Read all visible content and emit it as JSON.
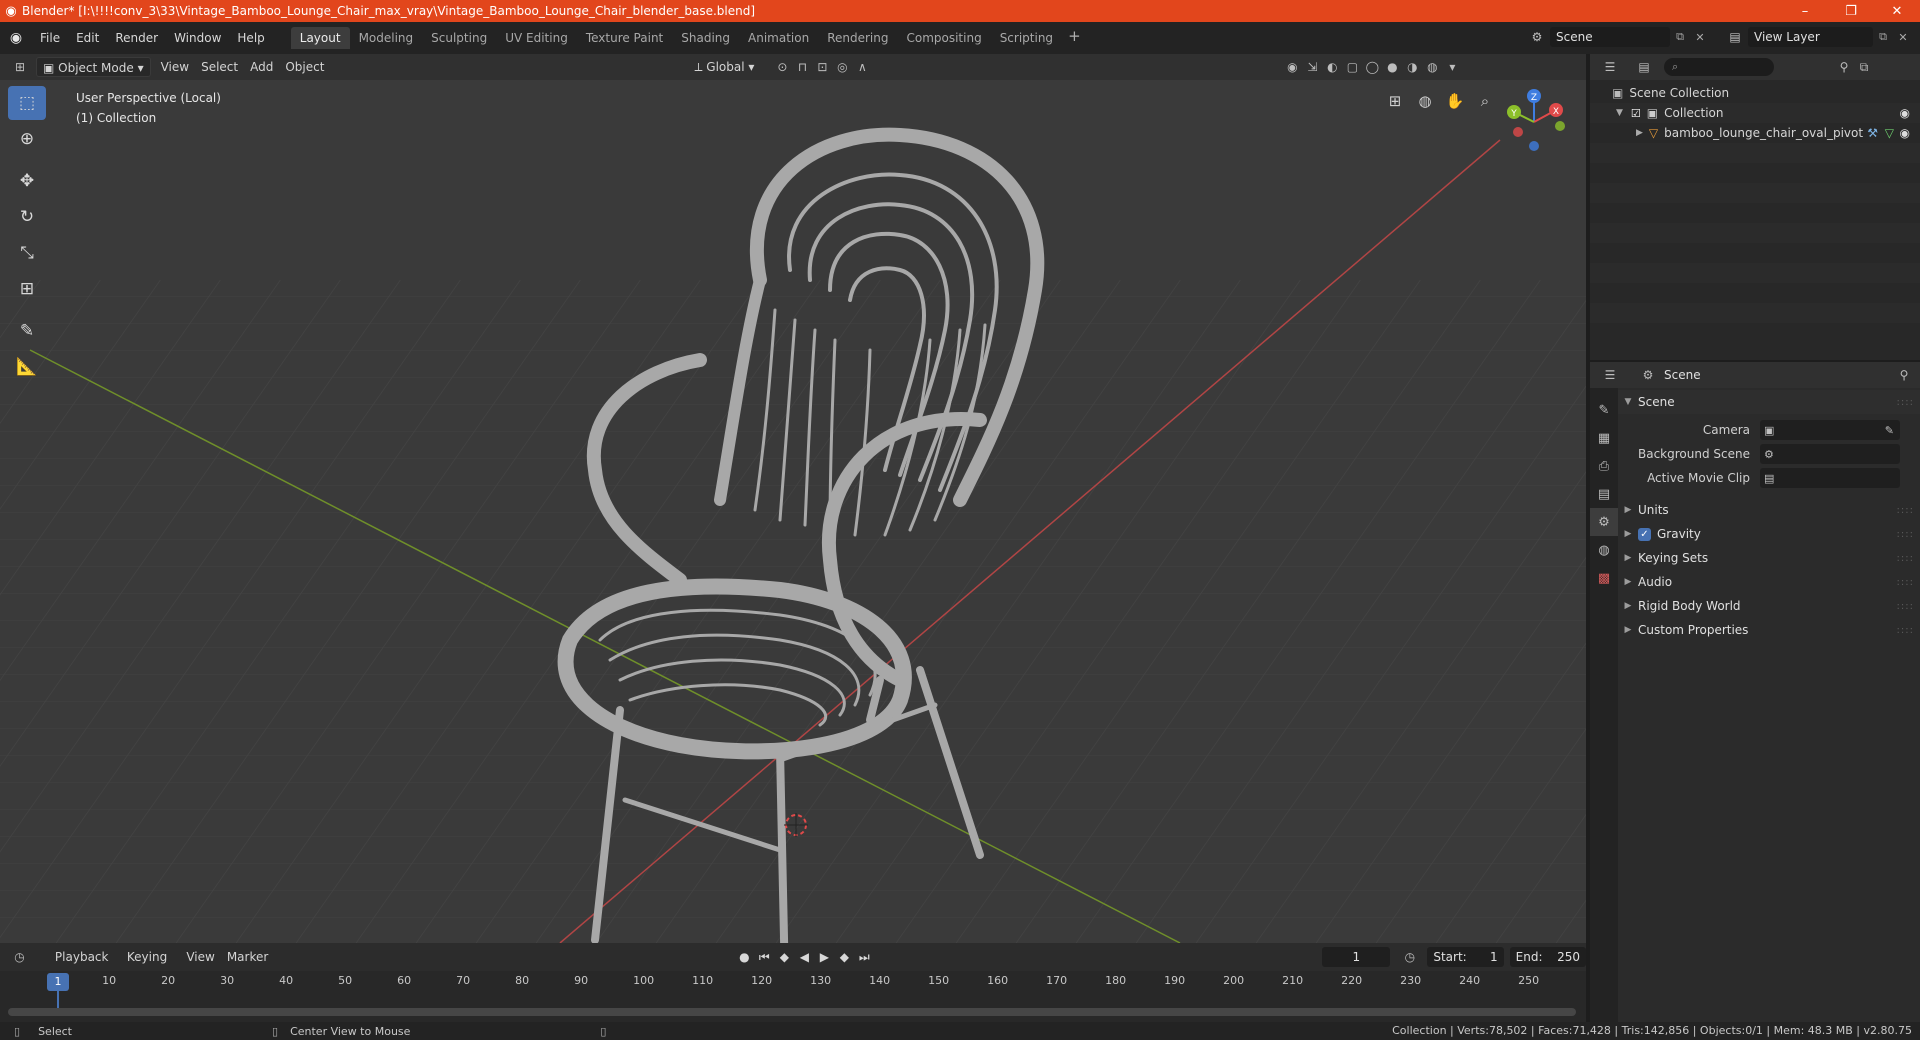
{
  "window": {
    "title": "Blender* [I:\\!!!!conv_3\\33\\Vintage_Bamboo_Lounge_Chair_max_vray\\Vintage_Bamboo_Lounge_Chair_blender_base.blend]",
    "minimize": "–",
    "maximize": "❐",
    "close": "✕"
  },
  "menu": [
    "File",
    "Edit",
    "Render",
    "Window",
    "Help"
  ],
  "workspaces": [
    "Layout",
    "Modeling",
    "Sculpting",
    "UV Editing",
    "Texture Paint",
    "Shading",
    "Animation",
    "Rendering",
    "Compositing",
    "Scripting"
  ],
  "active_workspace": "Layout",
  "scene_selector": "Scene",
  "view_layer_selector": "View Layer",
  "viewport_header": {
    "mode": "Object Mode",
    "menus": [
      "View",
      "Select",
      "Add",
      "Object"
    ],
    "orientation": "Global"
  },
  "viewport": {
    "perspective_label": "User Perspective (Local)",
    "collection_label": "(1) Collection",
    "gizmo_axes": {
      "x": "X",
      "y": "Y",
      "z": "Z"
    }
  },
  "timeline": {
    "menus": [
      "Playback",
      "Keying",
      "View",
      "Marker"
    ],
    "current_frame": "1",
    "start_label": "Start:",
    "start": "1",
    "end_label": "End:",
    "end": "250",
    "ruler": [
      "10",
      "20",
      "30",
      "40",
      "50",
      "60",
      "70",
      "80",
      "90",
      "100",
      "110",
      "120",
      "130",
      "140",
      "150",
      "160",
      "170",
      "180",
      "190",
      "200",
      "210",
      "220",
      "230",
      "240",
      "250"
    ],
    "cursor_frame": "1"
  },
  "statusbar": {
    "left_action": "Select",
    "middle_action": "Center View to Mouse",
    "stats": "Collection | Verts:78,502 | Faces:71,428 | Tris:142,856 | Objects:0/1 | Mem: 48.3 MB | v2.80.75"
  },
  "outliner": {
    "root": "Scene Collection",
    "collection": "Collection",
    "object": "bamboo_lounge_chair_oval_pivot"
  },
  "properties": {
    "header_title": "Scene",
    "panel_title": "Scene",
    "fields": [
      {
        "label": "Camera"
      },
      {
        "label": "Background Scene"
      },
      {
        "label": "Active Movie Clip"
      }
    ],
    "sections": [
      {
        "label": "Units",
        "checkbox": false
      },
      {
        "label": "Gravity",
        "checkbox": true
      },
      {
        "label": "Keying Sets",
        "checkbox": false
      },
      {
        "label": "Audio",
        "checkbox": false
      },
      {
        "label": "Rigid Body World",
        "checkbox": false
      },
      {
        "label": "Custom Properties",
        "checkbox": false
      }
    ]
  },
  "colors": {
    "title_bar": "#e2461c",
    "accent": "#4772b3",
    "x_axis": "#e04a4a",
    "y_axis": "#8cbf2a",
    "z_axis": "#3f7de0",
    "viewport_bg": "#3a3a3a"
  }
}
